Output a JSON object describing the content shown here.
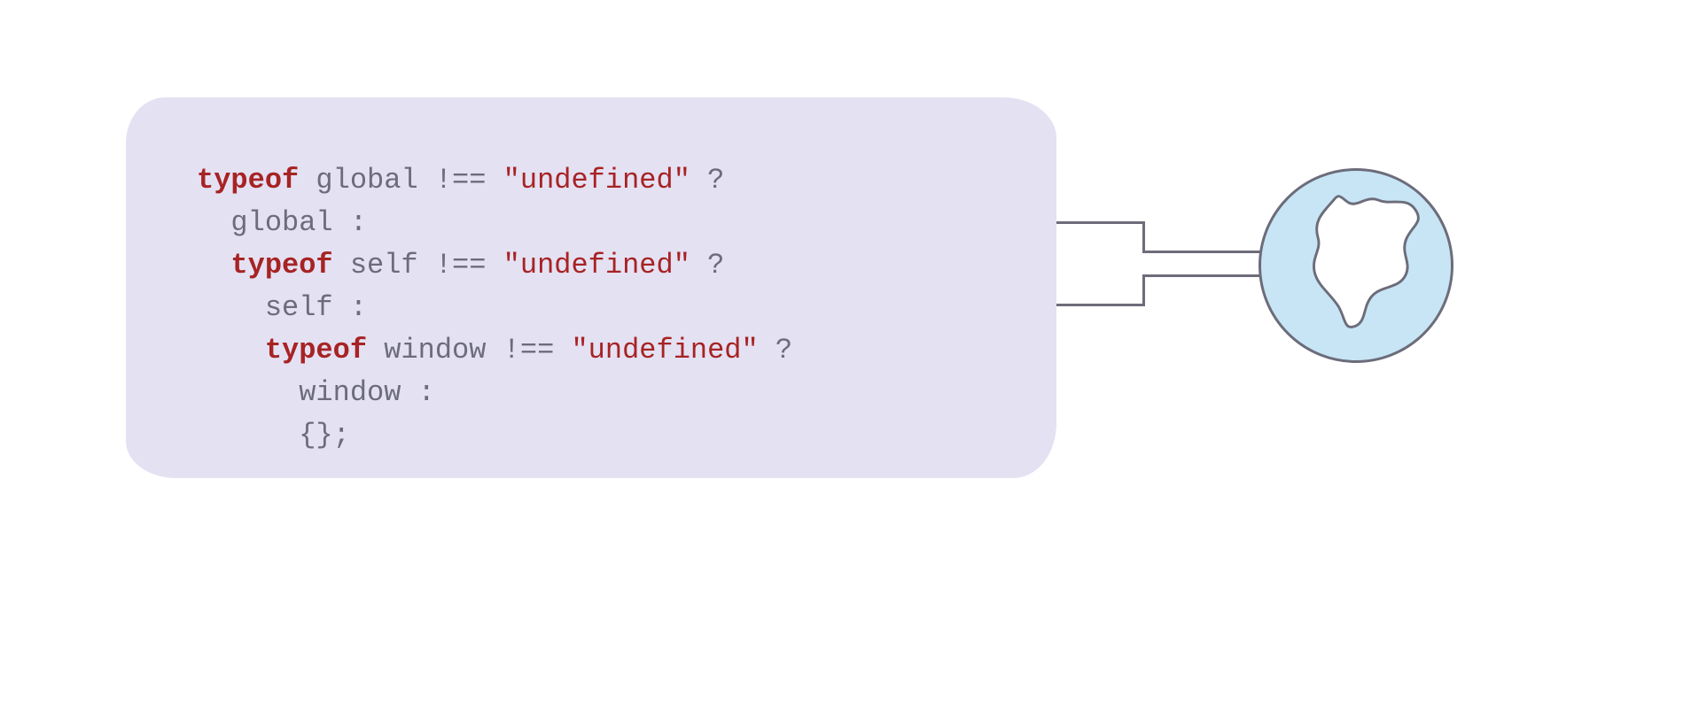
{
  "code": {
    "line1": {
      "kw": "typeof",
      "ident": " global !== ",
      "str": "\"undefined\"",
      "tail": " ?"
    },
    "line2": "  global :",
    "line3": {
      "indent": "  ",
      "kw": "typeof",
      "ident": " self !== ",
      "str": "\"undefined\"",
      "tail": " ?"
    },
    "line4": "    self :",
    "line5": {
      "indent": "    ",
      "kw": "typeof",
      "ident": " window !== ",
      "str": "\"undefined\"",
      "tail": " ?"
    },
    "line6": "      window :",
    "line7": "      {};"
  },
  "icons": {
    "globe": "globe-icon"
  },
  "colors": {
    "panel_bg": "#e4e1f3",
    "keyword": "#a72323",
    "string": "#a72323",
    "text": "#6c6c7a",
    "globe_fill": "#c7e5f5",
    "globe_stroke": "#6c6c7a",
    "continent_fill": "#ffffff"
  }
}
